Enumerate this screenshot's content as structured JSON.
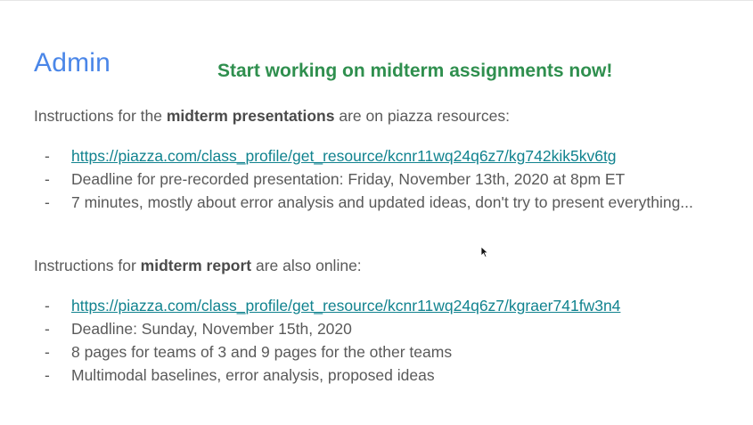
{
  "slide": {
    "title": "Admin",
    "banner": "Start working on midterm assignments now!",
    "section1": {
      "intro_prefix": "Instructions for the ",
      "intro_bold": "midterm presentations",
      "intro_suffix": " are on piazza resources:",
      "items": [
        {
          "text": "https://piazza.com/class_profile/get_resource/kcnr11wq24q6z7/kg742kik5kv6tg",
          "is_link": true
        },
        {
          "text": "Deadline for pre-recorded presentation: Friday, November 13th, 2020 at 8pm ET",
          "is_link": false
        },
        {
          "text": "7 minutes, mostly about error analysis and updated ideas, don't try to present everything...",
          "is_link": false
        }
      ]
    },
    "section2": {
      "intro_prefix": "Instructions for ",
      "intro_bold": "midterm report",
      "intro_suffix": " are also online:",
      "items": [
        {
          "text": "https://piazza.com/class_profile/get_resource/kcnr11wq24q6z7/kgraer741fw3n4",
          "is_link": true
        },
        {
          "text": "Deadline: Sunday, November 15th, 2020",
          "is_link": false
        },
        {
          "text": "8 pages for teams of 3 and 9 pages for the other teams",
          "is_link": false
        },
        {
          "text": "Multimodal baselines, error analysis, proposed ideas",
          "is_link": false
        }
      ]
    },
    "bullet_marker": "-"
  },
  "colors": {
    "title": "#4a86e8",
    "banner": "#2f8f4e",
    "body_text": "#595959",
    "link": "#11838f"
  },
  "icons": {
    "cursor": "mouse-pointer-icon"
  }
}
